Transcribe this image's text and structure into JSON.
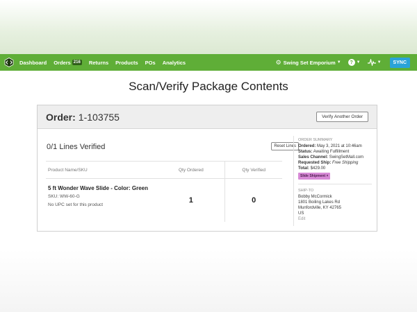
{
  "nav": {
    "items": [
      {
        "label": "Dashboard"
      },
      {
        "label": "Orders",
        "badge": "216"
      },
      {
        "label": "Returns"
      },
      {
        "label": "Products"
      },
      {
        "label": "POs"
      },
      {
        "label": "Analytics"
      }
    ],
    "store_name": "Swing Set Emporium",
    "help_icon": "?",
    "sync_label": "SYNC",
    "brand_color": "#5fae37",
    "sync_color": "#2aa3d8"
  },
  "page": {
    "title": "Scan/Verify Package Contents"
  },
  "order": {
    "label": "Order:",
    "number": "1-103755",
    "verify_button": "Verify Another Order",
    "lines_verified": "0/1 Lines Verified",
    "reset_button": "Reset Lines",
    "columns": [
      "Product Name/SKU",
      "Qty Ordered",
      "Qty Verified"
    ],
    "rows": [
      {
        "name": "5 ft Wonder Wave Slide - Color: Green",
        "sku": "SKU: WW-60-G",
        "upc": "No UPC set for this product",
        "qty_ordered": "1",
        "qty_verified": "0"
      }
    ]
  },
  "summary": {
    "title": "ORDER SUMMARY",
    "ordered_label": "Ordered:",
    "ordered_value": "May 3, 2021 at 10:46am",
    "status_label": "Status:",
    "status_value": "Awaiting Fulfillment",
    "channel_label": "Sales Channel:",
    "channel_value": "SwingSetMall.com",
    "ship_label": "Requested Ship:",
    "ship_value": "Free Shipping",
    "total_label": "Total:",
    "total_value": "$429.00",
    "tag": "Slide Shipment",
    "tag_close": "×",
    "tag_color": "#d78ad6"
  },
  "ship_to": {
    "title": "SHIP-TO",
    "name": "Bobby McCormick",
    "street": "1801 Boiling Lakes Rd",
    "city": "Munfordville, KY 42765",
    "country": "US",
    "edit": "Edit"
  }
}
